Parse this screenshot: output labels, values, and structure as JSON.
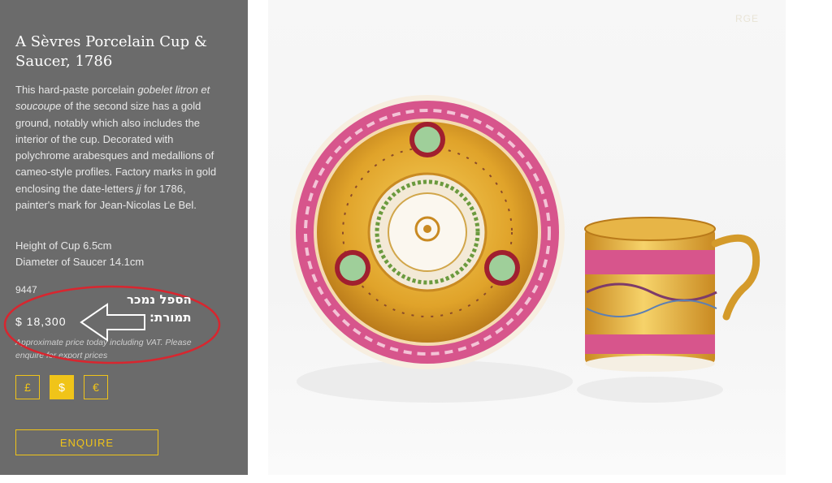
{
  "product": {
    "title": "A Sèvres Porcelain Cup & Saucer, 1786",
    "description_parts": [
      "This hard-paste porcelain ",
      "gobelet litron et soucoupe",
      " of the second size has a gold ground, notably which also includes the interior of the cup. Decorated with polychrome arabesques and medallions of cameo-style profiles. Factory marks in gold enclosing the date-letters ",
      "jj",
      " for 1786, painter's mark for Jean-Nicolas Le Bel."
    ],
    "height": "Height of Cup 6.5cm",
    "diameter": "Diameter of Saucer 14.1cm",
    "reference": "9447",
    "price": "$ 18,300",
    "price_note": "Approximate price today including VAT. Please enquire for export prices"
  },
  "currencies": [
    {
      "symbol": "£",
      "active": false
    },
    {
      "symbol": "$",
      "active": true
    },
    {
      "symbol": "€",
      "active": false
    }
  ],
  "enquire_label": "ENQUIRE",
  "image": {
    "large_label": "RGE"
  },
  "annotation": {
    "line1": "הספל נמכר",
    "line2": "תמורת:",
    "circle_color": "#d8262f",
    "arrow_color": "#ffffff"
  },
  "colors": {
    "sidebar": "#6b6b6b",
    "accent": "#f0c419"
  }
}
